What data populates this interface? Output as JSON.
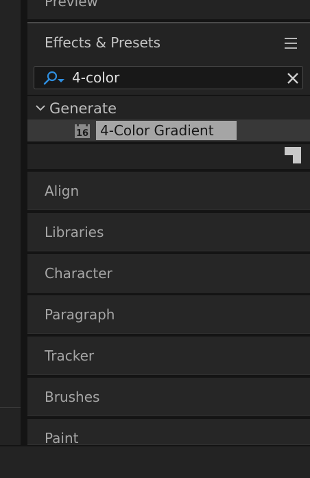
{
  "panels": {
    "preview": {
      "title": "Preview"
    },
    "effects_presets": {
      "title": "Effects & Presets",
      "search": {
        "value": "4-color"
      },
      "tree": {
        "category": "Generate",
        "items": [
          {
            "label": "4-Color Gradient",
            "bit_depth_badge": "16"
          }
        ]
      }
    },
    "collapsed": [
      "Align",
      "Libraries",
      "Character",
      "Paragraph",
      "Tracker",
      "Brushes",
      "Paint"
    ]
  },
  "colors": {
    "background": "#1d1d1d",
    "panel": "#232323",
    "accent_blue": "#2f8fe0",
    "selection": "#a5a5a5"
  },
  "icons": [
    "menu-icon",
    "search-icon",
    "clear-icon",
    "chevron-down-icon",
    "effect-16bpc-icon",
    "new-folder-icon"
  ]
}
